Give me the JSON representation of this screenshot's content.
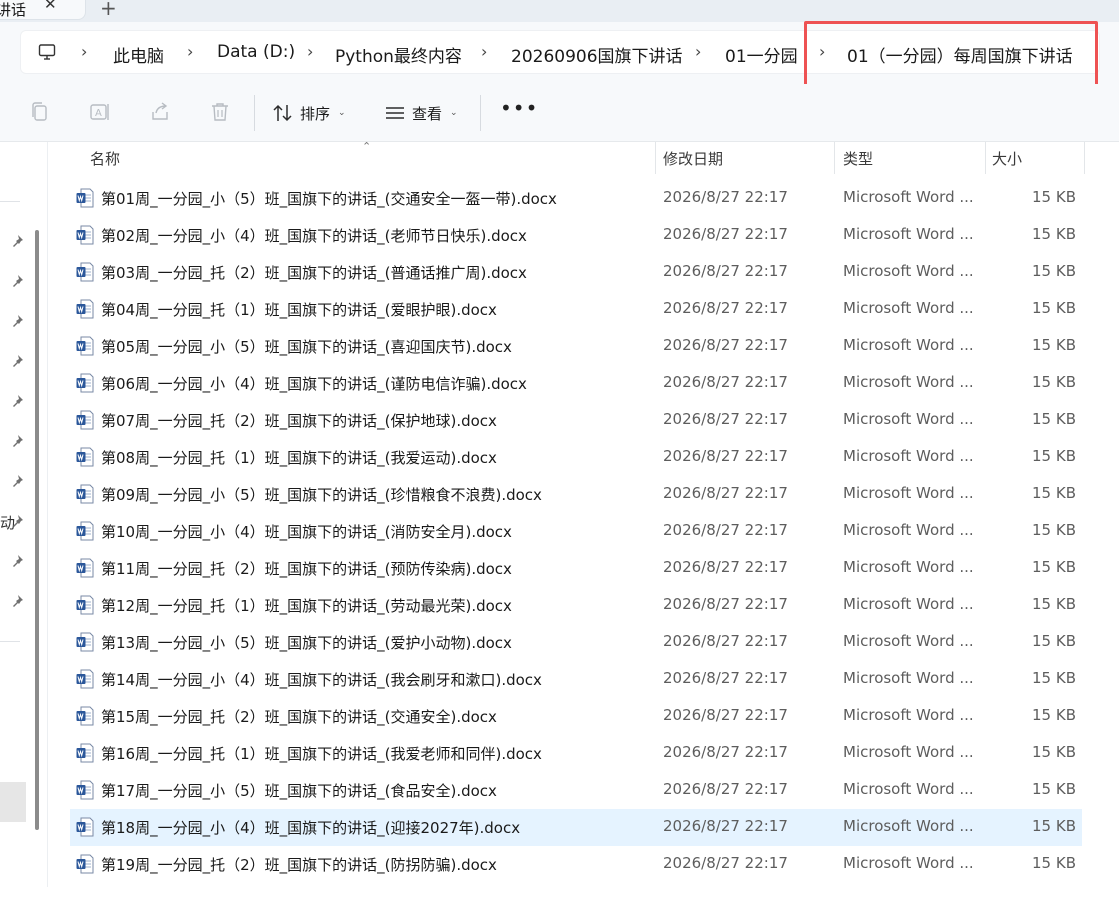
{
  "tab": {
    "title": "讲话",
    "close_glyph": "✕",
    "new_glyph": "+"
  },
  "address": {
    "crumbs": [
      "此电脑",
      "Data (D:)",
      "Python最终内容",
      "20260906国旗下讲话",
      "01一分园",
      "01（一分园）每周国旗下讲话"
    ],
    "separator": "›"
  },
  "toolbar": {
    "sort_label": "排序",
    "view_label": "查看",
    "more_label": "•••",
    "caret": "⌄"
  },
  "nav": {
    "truncated_label": "动"
  },
  "columns": {
    "name": "名称",
    "date": "修改日期",
    "type": "类型",
    "size": "大小",
    "sort_glyph": "⌃"
  },
  "files": [
    {
      "name": "第01周_一分园_小（5）班_国旗下的讲话_(交通安全一盔一带).docx",
      "date": "2026/8/27 22:17",
      "type": "Microsoft Word ...",
      "size": "15 KB"
    },
    {
      "name": "第02周_一分园_小（4）班_国旗下的讲话_(老师节日快乐).docx",
      "date": "2026/8/27 22:17",
      "type": "Microsoft Word ...",
      "size": "15 KB"
    },
    {
      "name": "第03周_一分园_托（2）班_国旗下的讲话_(普通话推广周).docx",
      "date": "2026/8/27 22:17",
      "type": "Microsoft Word ...",
      "size": "15 KB"
    },
    {
      "name": "第04周_一分园_托（1）班_国旗下的讲话_(爱眼护眼).docx",
      "date": "2026/8/27 22:17",
      "type": "Microsoft Word ...",
      "size": "15 KB"
    },
    {
      "name": "第05周_一分园_小（5）班_国旗下的讲话_(喜迎国庆节).docx",
      "date": "2026/8/27 22:17",
      "type": "Microsoft Word ...",
      "size": "15 KB"
    },
    {
      "name": "第06周_一分园_小（4）班_国旗下的讲话_(谨防电信诈骗).docx",
      "date": "2026/8/27 22:17",
      "type": "Microsoft Word ...",
      "size": "15 KB"
    },
    {
      "name": "第07周_一分园_托（2）班_国旗下的讲话_(保护地球).docx",
      "date": "2026/8/27 22:17",
      "type": "Microsoft Word ...",
      "size": "15 KB"
    },
    {
      "name": "第08周_一分园_托（1）班_国旗下的讲话_(我爱运动).docx",
      "date": "2026/8/27 22:17",
      "type": "Microsoft Word ...",
      "size": "15 KB"
    },
    {
      "name": "第09周_一分园_小（5）班_国旗下的讲话_(珍惜粮食不浪费).docx",
      "date": "2026/8/27 22:17",
      "type": "Microsoft Word ...",
      "size": "15 KB"
    },
    {
      "name": "第10周_一分园_小（4）班_国旗下的讲话_(消防安全月).docx",
      "date": "2026/8/27 22:17",
      "type": "Microsoft Word ...",
      "size": "15 KB"
    },
    {
      "name": "第11周_一分园_托（2）班_国旗下的讲话_(预防传染病).docx",
      "date": "2026/8/27 22:17",
      "type": "Microsoft Word ...",
      "size": "15 KB"
    },
    {
      "name": "第12周_一分园_托（1）班_国旗下的讲话_(劳动最光荣).docx",
      "date": "2026/8/27 22:17",
      "type": "Microsoft Word ...",
      "size": "15 KB"
    },
    {
      "name": "第13周_一分园_小（5）班_国旗下的讲话_(爱护小动物).docx",
      "date": "2026/8/27 22:17",
      "type": "Microsoft Word ...",
      "size": "15 KB"
    },
    {
      "name": "第14周_一分园_小（4）班_国旗下的讲话_(我会刷牙和漱口).docx",
      "date": "2026/8/27 22:17",
      "type": "Microsoft Word ...",
      "size": "15 KB"
    },
    {
      "name": "第15周_一分园_托（2）班_国旗下的讲话_(交通安全).docx",
      "date": "2026/8/27 22:17",
      "type": "Microsoft Word ...",
      "size": "15 KB"
    },
    {
      "name": "第16周_一分园_托（1）班_国旗下的讲话_(我爱老师和同伴).docx",
      "date": "2026/8/27 22:17",
      "type": "Microsoft Word ...",
      "size": "15 KB"
    },
    {
      "name": "第17周_一分园_小（5）班_国旗下的讲话_(食品安全).docx",
      "date": "2026/8/27 22:17",
      "type": "Microsoft Word ...",
      "size": "15 KB"
    },
    {
      "name": "第18周_一分园_小（4）班_国旗下的讲话_(迎接2027年).docx",
      "date": "2026/8/27 22:17",
      "type": "Microsoft Word ...",
      "size": "15 KB",
      "selected": true
    },
    {
      "name": "第19周_一分园_托（2）班_国旗下的讲话_(防拐防骗).docx",
      "date": "2026/8/27 22:17",
      "type": "Microsoft Word ...",
      "size": "15 KB"
    }
  ],
  "colors": {
    "accent_highlight": "#ee5253",
    "selected_row": "#e5f3ff",
    "word_blue": "#2b579a"
  },
  "icons": [
    "computer-icon",
    "copy-icon",
    "rename-icon",
    "share-icon",
    "delete-icon",
    "sort-icon",
    "view-icon",
    "pin-icon",
    "word-doc-icon"
  ]
}
